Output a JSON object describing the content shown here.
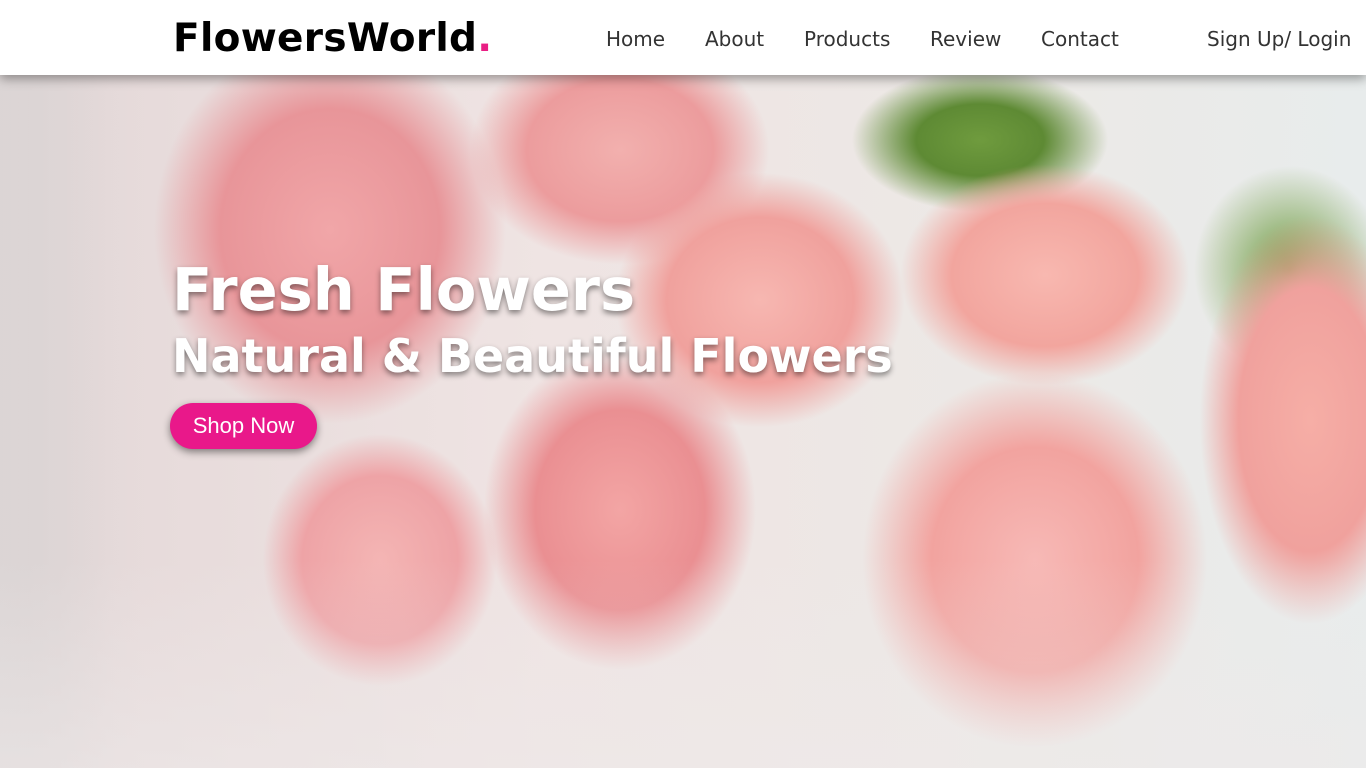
{
  "header": {
    "logo": {
      "text": "FlowersWorld",
      "dot": "."
    },
    "nav": [
      {
        "id": "home",
        "label": "Home"
      },
      {
        "id": "about",
        "label": "About"
      },
      {
        "id": "products",
        "label": "Products"
      },
      {
        "id": "review",
        "label": "Review"
      },
      {
        "id": "contact",
        "label": "Contact"
      }
    ],
    "auth_label": "Sign Up/ Login"
  },
  "hero": {
    "title": "Fresh Flowers",
    "subtitle": "Natural & Beautiful Flowers",
    "cta_label": "Shop Now",
    "background": "pink-roses-photo"
  },
  "colors": {
    "accent": "#e9188a",
    "header_bg": "#ffffff",
    "nav_text": "#333333",
    "hero_text": "#ffffff"
  }
}
